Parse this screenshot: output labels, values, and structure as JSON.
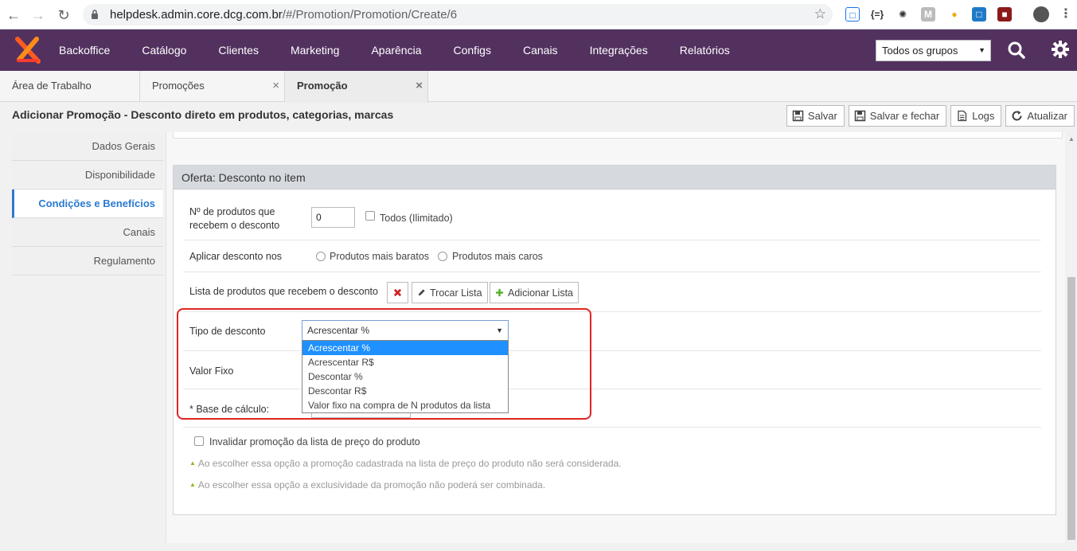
{
  "browser": {
    "url_host": "helpdesk.admin.core.dcg.com.br",
    "url_path": "/#/Promotion/Promotion/Create/6"
  },
  "nav": {
    "items": [
      "Backoffice",
      "Catálogo",
      "Clientes",
      "Marketing",
      "Aparência",
      "Configs",
      "Canais",
      "Integrações",
      "Relatórios"
    ],
    "group_select": "Todos os grupos"
  },
  "tabs": [
    {
      "label": "Área de Trabalho"
    },
    {
      "label": "Promoções",
      "close": "×"
    },
    {
      "label": "Promoção",
      "close": "×"
    }
  ],
  "page": {
    "title": "Adicionar Promoção - Desconto direto em produtos, categorias, marcas",
    "actions": [
      "Salvar",
      "Salvar e fechar",
      "Logs",
      "Atualizar"
    ]
  },
  "sidemenu": [
    "Dados Gerais",
    "Disponibilidade",
    "Condições e Benefícios",
    "Canais",
    "Regulamento"
  ],
  "panel": {
    "title": "Oferta: Desconto no item",
    "qty_label": "Nº de produtos que recebem o desconto",
    "qty_value": "0",
    "all_label": "Todos (Ilimitado)",
    "apply_label": "Aplicar desconto nos",
    "cheapest": "Produtos mais baratos",
    "expensive": "Produtos mais caros",
    "list_label": "Lista de produtos que recebem o desconto",
    "swap_list": "Trocar Lista",
    "add_list": "Adicionar Lista",
    "discount_type_label": "Tipo de desconto",
    "discount_type_value": "Acrescentar %",
    "discount_options": [
      "Acrescentar %",
      "Acrescentar R$",
      "Descontar %",
      "Descontar R$",
      "Valor fixo na compra de N produtos da lista"
    ],
    "fixed_value_label": "Valor Fixo",
    "base_label": "* Base de cálculo:",
    "invalidate_label": "Invalidar promoção da lista de preço do produto",
    "note1": "Ao escolher essa opção a promoção cadastrada na lista de preço do produto não será considerada.",
    "note2": "Ao escolher essa opção a exclusividade da promoção não poderá ser combinada."
  },
  "colors": {
    "nav_bg": "#52315f",
    "accent": "#2a7ad1",
    "highlight": "#e02424",
    "selected_option": "#1e90ff"
  }
}
